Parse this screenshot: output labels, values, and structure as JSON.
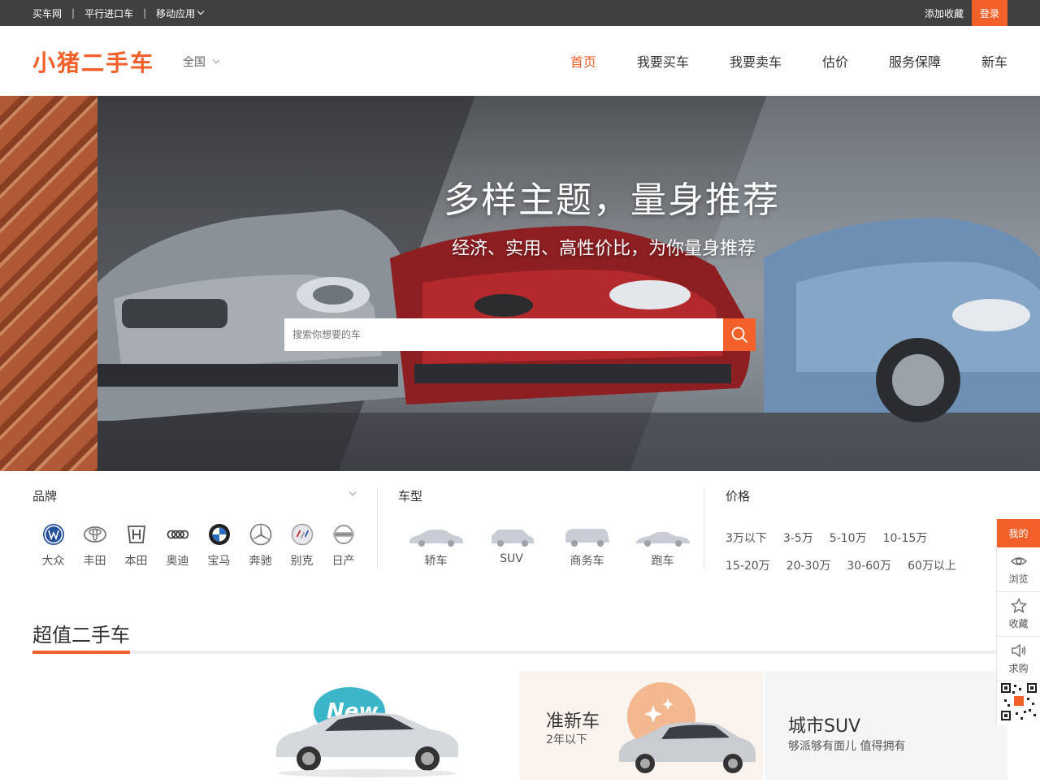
{
  "topbar": {
    "links": [
      "买车网",
      "平行进口车",
      "移动应用"
    ],
    "separator": "|",
    "favorite": "添加收藏",
    "login": "登录"
  },
  "header": {
    "logo": "小猪二手车",
    "city": "全国",
    "nav": [
      "首页",
      "我要买车",
      "我要卖车",
      "估价",
      "服务保障",
      "新车"
    ],
    "active_nav": "首页"
  },
  "hero": {
    "title": "多样主题，量身推荐",
    "subtitle": "经济、实用、高性价比，为你量身推荐",
    "search_placeholder": "搜索你想要的车"
  },
  "filters": {
    "brand_title": "品牌",
    "brands": [
      "大众",
      "丰田",
      "本田",
      "奥迪",
      "宝马",
      "奔驰",
      "别克",
      "日产"
    ],
    "type_title": "车型",
    "types": [
      "轿车",
      "SUV",
      "商务车",
      "跑车"
    ],
    "price_title": "价格",
    "prices": [
      "3万以下",
      "3-5万",
      "5-10万",
      "10-15万",
      "15-20万",
      "20-30万",
      "30-60万",
      "60万以上"
    ]
  },
  "section": {
    "title": "超值二手车",
    "cards": [
      {
        "badge": "New"
      },
      {
        "title": "准新车",
        "subtitle": "2年以下"
      },
      {
        "title": "城市SUV",
        "subtitle": "够派够有面儿 值得拥有"
      }
    ]
  },
  "sidebar": {
    "mine": "我的",
    "items": [
      "浏览",
      "收藏",
      "求购"
    ]
  },
  "colors": {
    "accent": "#f4602a",
    "topbar": "#404040"
  }
}
